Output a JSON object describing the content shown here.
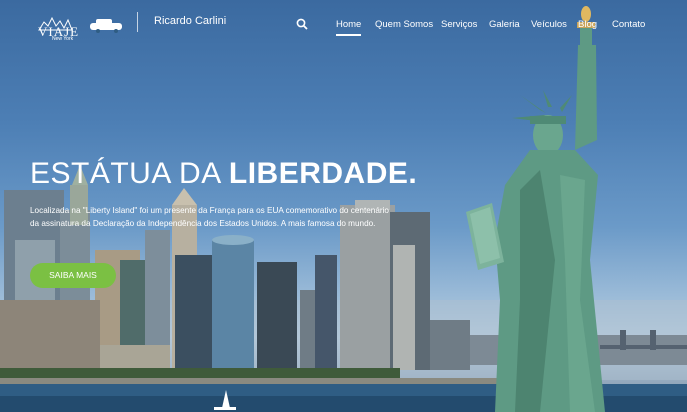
{
  "brand": {
    "logo_text": "VIAJE",
    "logo_subtext": "New York",
    "user_name": "Ricardo Carlini"
  },
  "search_icon": "search-icon",
  "nav": {
    "items": [
      {
        "label": "Home",
        "active": true
      },
      {
        "label": "Quem Somos",
        "active": false
      },
      {
        "label": "Serviços",
        "active": false
      },
      {
        "label": "Galeria",
        "active": false
      },
      {
        "label": "Veículos",
        "active": false
      },
      {
        "label": "Blog",
        "active": false
      },
      {
        "label": "Contato",
        "active": false
      }
    ]
  },
  "hero": {
    "title_regular": "ESTÁTUA DA ",
    "title_bold": "LIBERDADE.",
    "description": "Localizada na \"Liberty Island\" foi um presente da França para os EUA comemorativo do centenário da assinatura da Declaração da Independência dos Estados Unidos. A mais famosa do mundo.",
    "cta_label": "SAIBA MAIS"
  },
  "colors": {
    "accent": "#7bc043",
    "text": "#ffffff",
    "sky": "#4d7fb5",
    "statue": "#5e9a84"
  }
}
